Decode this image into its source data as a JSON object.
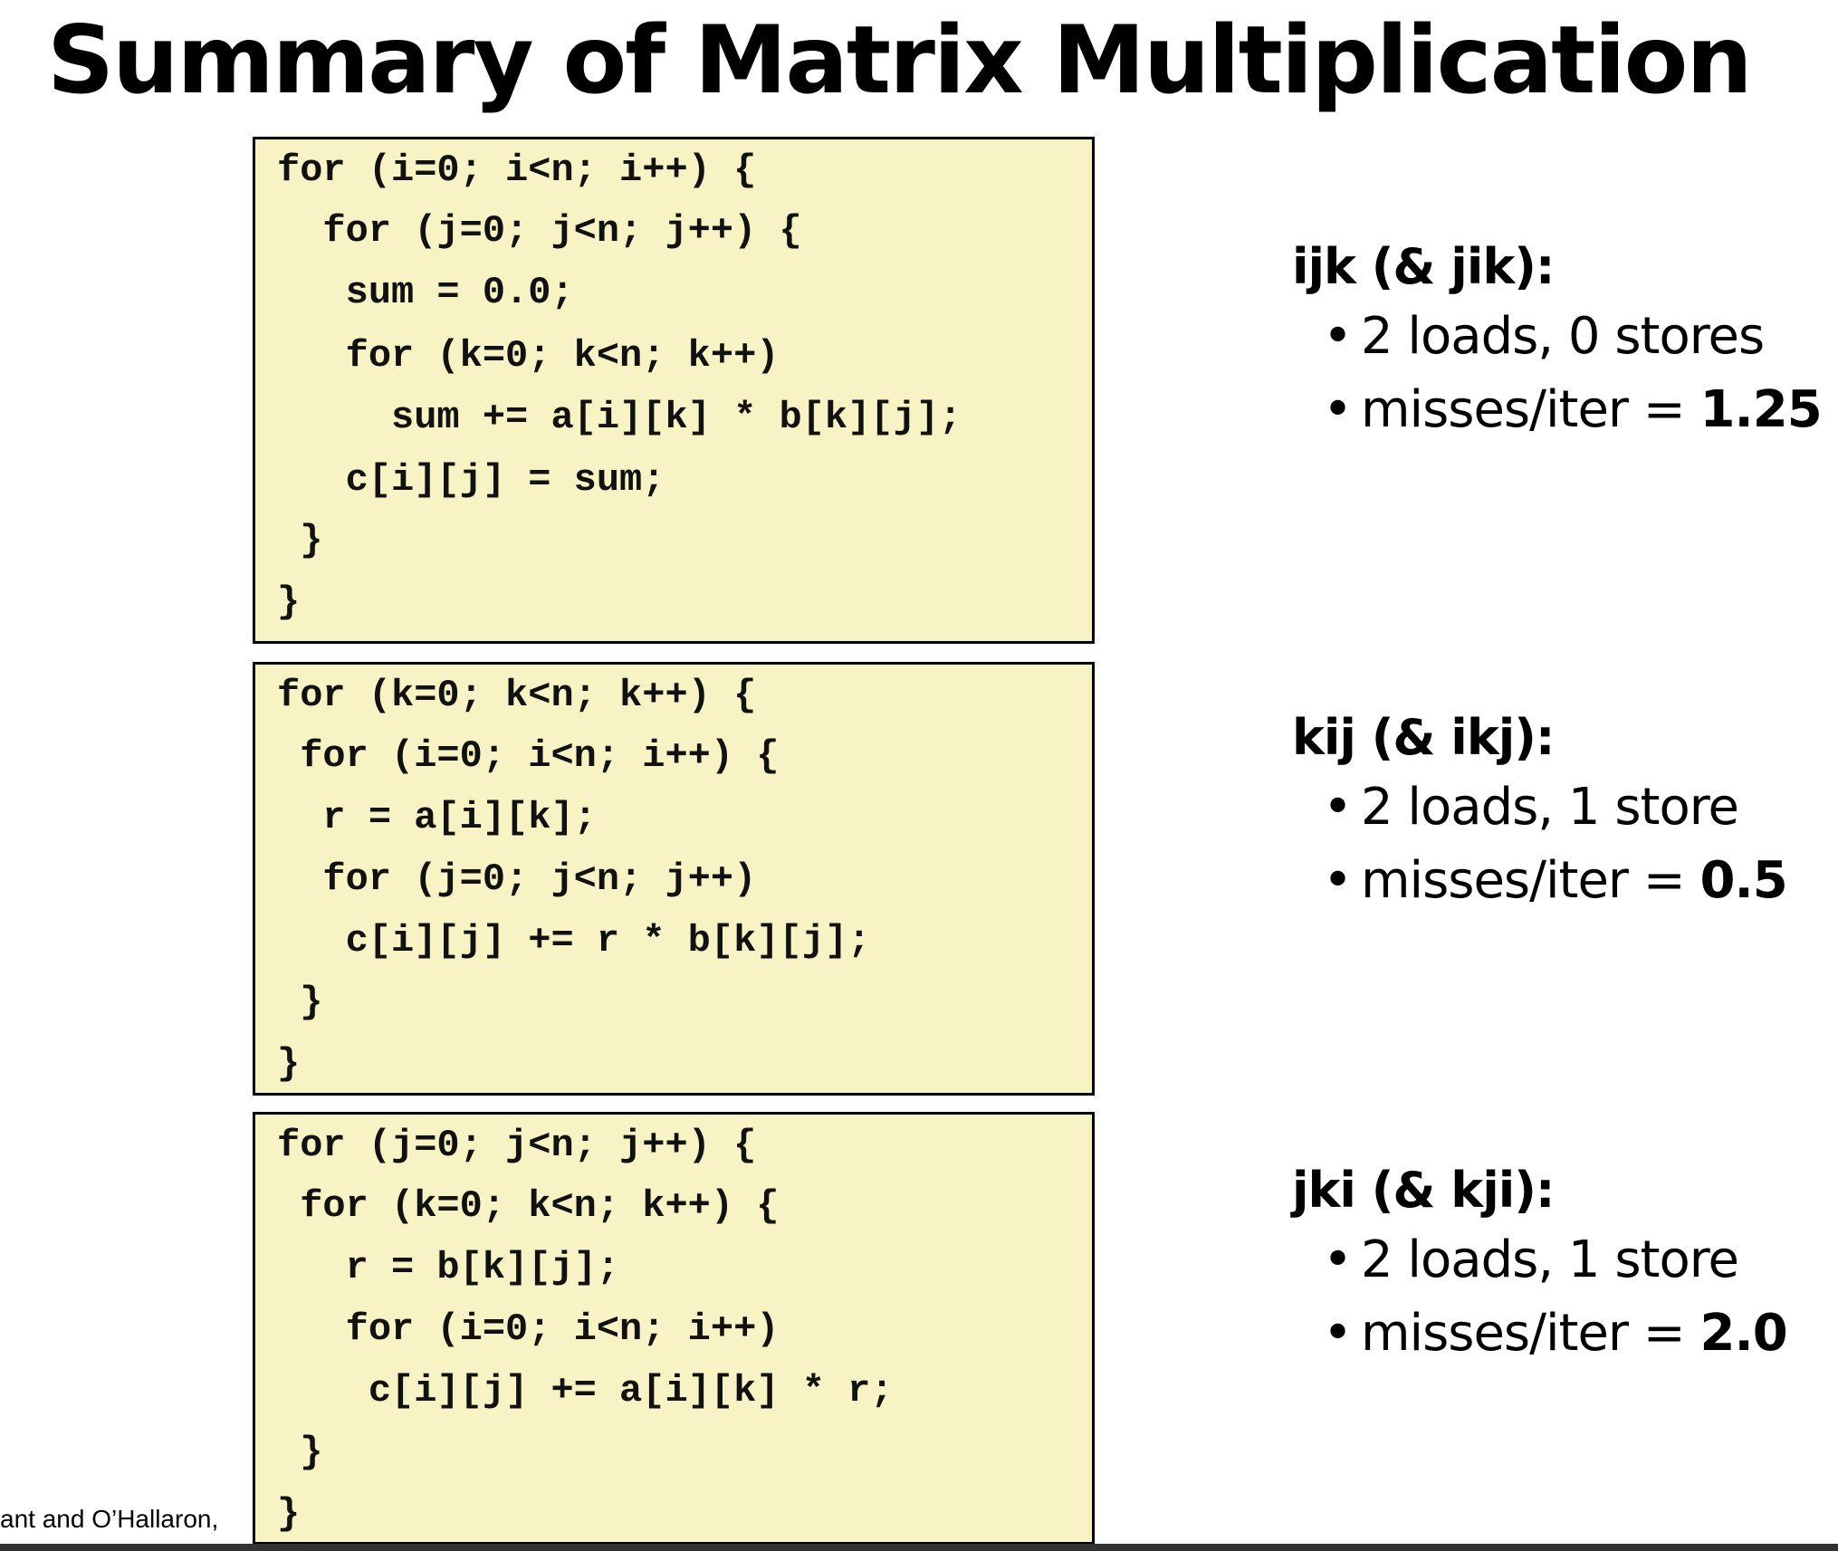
{
  "title": "Summary of Matrix Multiplication",
  "blocks": [
    {
      "lines": [
        "for (i=0; i<n; i++) {",
        "  for (j=0; j<n; j++) {",
        "   sum = 0.0;",
        "   for (k=0; k<n; k++)",
        "     sum += a[i][k] * b[k][j];",
        "   c[i][j] = sum;",
        " }",
        "}"
      ],
      "heading": "ijk (& jik):",
      "bullets": [
        {
          "text": "2 loads, 0 stores",
          "value": ""
        },
        {
          "text": "misses/iter = ",
          "value": "1.25"
        }
      ]
    },
    {
      "lines": [
        "for (k=0; k<n; k++) {",
        " for (i=0; i<n; i++) {",
        "  r = a[i][k];",
        "  for (j=0; j<n; j++)",
        "   c[i][j] += r * b[k][j];",
        " }",
        "}"
      ],
      "heading": "kij (& ikj):",
      "bullets": [
        {
          "text": "2 loads, 1 store",
          "value": ""
        },
        {
          "text": "misses/iter = ",
          "value": "0.5"
        }
      ]
    },
    {
      "lines": [
        "for (j=0; j<n; j++) {",
        " for (k=0; k<n; k++) {",
        "   r = b[k][j];",
        "   for (i=0; i<n; i++)",
        "    c[i][j] += a[i][k] * r;",
        " }",
        "}"
      ],
      "heading": "jki (& kji):",
      "bullets": [
        {
          "text": "2 loads, 1 store",
          "value": ""
        },
        {
          "text": "misses/iter = ",
          "value": "2.0"
        }
      ]
    }
  ],
  "footer": "ant and O’Hallaron, "
}
